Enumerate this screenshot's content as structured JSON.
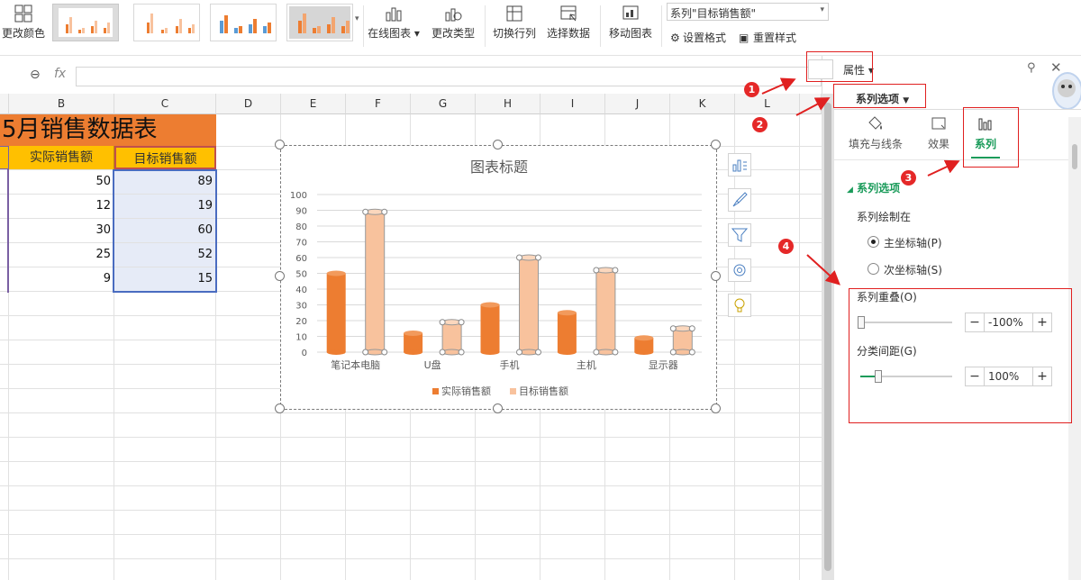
{
  "ribbon": {
    "change_color_label": "更改颜色",
    "online_chart_label": "在线图表",
    "change_type_label": "更改类型",
    "switch_row_col_label": "切换行列",
    "select_data_label": "选择数据",
    "move_chart_label": "移动图表",
    "series_select_value": "系列\"目标销售额\"",
    "set_format_label": "设置格式",
    "reset_style_label": "重置样式"
  },
  "formula_bar": {
    "fx_label": "fx",
    "value": ""
  },
  "columns": [
    "B",
    "C",
    "D",
    "E",
    "F",
    "G",
    "H",
    "I",
    "J",
    "K",
    "L"
  ],
  "sheet": {
    "title": "5月销售数据表",
    "header_actual": "实际销售额",
    "header_target": "目标销售额",
    "rows": [
      {
        "actual": "50",
        "target": "89"
      },
      {
        "actual": "12",
        "target": "19"
      },
      {
        "actual": "30",
        "target": "60"
      },
      {
        "actual": "25",
        "target": "52"
      },
      {
        "actual": "9",
        "target": "15"
      }
    ]
  },
  "chart_data": {
    "type": "bar",
    "title": "图表标题",
    "categories": [
      "笔记本电脑",
      "U盘",
      "手机",
      "主机",
      "显示器"
    ],
    "series": [
      {
        "name": "实际销售额",
        "values": [
          50,
          12,
          30,
          25,
          9
        ],
        "color": "#ed7d31"
      },
      {
        "name": "目标销售额",
        "values": [
          89,
          19,
          60,
          52,
          15
        ],
        "color": "#f8c29d",
        "selected": true
      }
    ],
    "ylim": [
      0,
      100
    ],
    "yticks": [
      "0",
      "10",
      "20",
      "30",
      "40",
      "50",
      "60",
      "70",
      "80",
      "90",
      "100"
    ],
    "grid": true,
    "legend": "bottom",
    "shape": "cylinder"
  },
  "pane": {
    "properties_label": "属性",
    "series_options_dropdown": "系列选项",
    "tab_fill_line": "填充与线条",
    "tab_effect": "效果",
    "tab_series": "系列",
    "section_title": "系列选项",
    "plot_on_label": "系列绘制在",
    "primary_axis_label": "主坐标轴(P)",
    "secondary_axis_label": "次坐标轴(S)",
    "overlap_label": "系列重叠(O)",
    "overlap_value": "-100%",
    "overlap_fraction": 0.0,
    "gap_label": "分类间距(G)",
    "gap_value": "100%",
    "gap_fraction": 0.2
  },
  "annotations": [
    "1",
    "2",
    "3",
    "4"
  ],
  "colors": {
    "accent_green": "#1a9b5a",
    "title_fill": "#ed7d31",
    "header_fill": "#ffc000",
    "annotation_red": "#e02020"
  }
}
